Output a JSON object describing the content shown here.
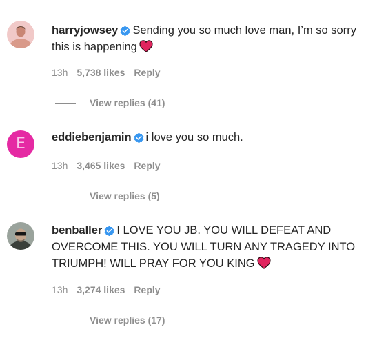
{
  "comments": [
    {
      "username": "harryjowsey",
      "verified": true,
      "avatar": "photo-shirtless-man",
      "text": "Sending you so much love man, I’m so sorry this is happening",
      "ends_with_heart": true,
      "time": "13h",
      "likes": "5,738 likes",
      "reply_label": "Reply",
      "view_replies": "View replies (41)"
    },
    {
      "username": "eddiebenjamin",
      "verified": true,
      "avatar": "letter-E",
      "avatar_letter": "E",
      "text": "i love you so much.",
      "ends_with_heart": false,
      "time": "13h",
      "likes": "3,465 likes",
      "reply_label": "Reply",
      "view_replies": "View replies (5)"
    },
    {
      "username": "benballer",
      "verified": true,
      "avatar": "photo-man-sunglasses",
      "text": "I LOVE YOU JB. YOU WILL DEFEAT AND OVERCOME THIS. YOU WILL TURN ANY TRAGEDY INTO TRIUMPH! WILL PRAY FOR YOU KING",
      "ends_with_heart": true,
      "time": "13h",
      "likes": "3,274 likes",
      "reply_label": "Reply",
      "view_replies": "View replies (17)"
    }
  ],
  "colors": {
    "text": "#262626",
    "muted": "#8e8e8e",
    "verified": "#3897f0",
    "heart": "#e0245e",
    "avatar_e": "#e52aa3"
  }
}
